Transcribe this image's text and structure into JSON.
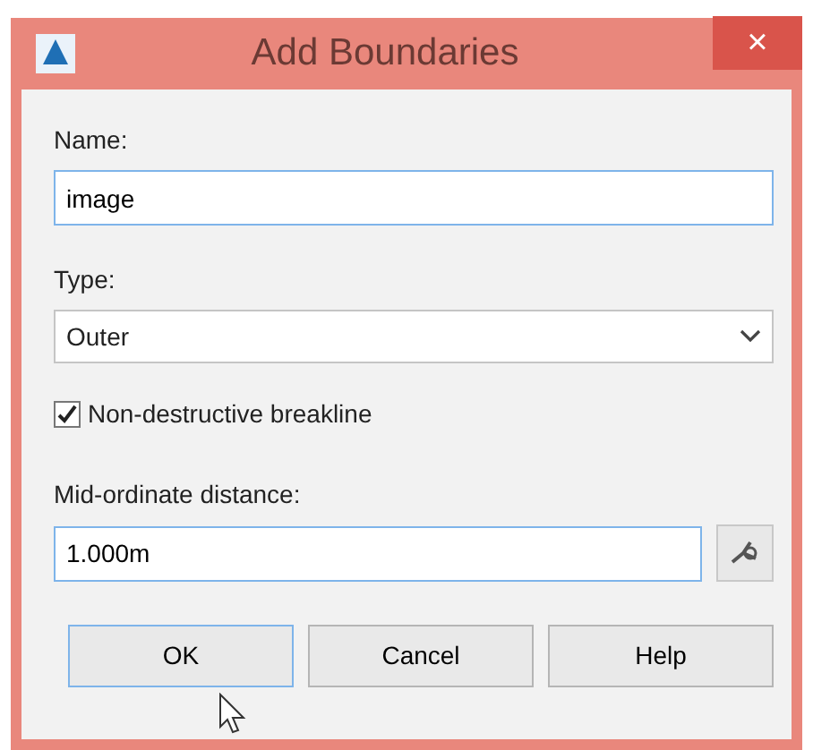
{
  "window": {
    "title": "Add Boundaries",
    "close": "×"
  },
  "fields": [
    {
      "kind": "text",
      "label": "Name:",
      "value": "image"
    },
    {
      "kind": "select",
      "label": "Type:",
      "value": "Outer"
    },
    {
      "kind": "checkbox",
      "label": "Non-destructive breakline",
      "checked": true
    },
    {
      "kind": "pick",
      "label": "Mid-ordinate distance:",
      "value": "1.000m"
    }
  ],
  "buttons": [
    {
      "label": "OK",
      "selected": true
    },
    {
      "label": "Cancel",
      "selected": false
    },
    {
      "label": "Help",
      "selected": false
    }
  ]
}
